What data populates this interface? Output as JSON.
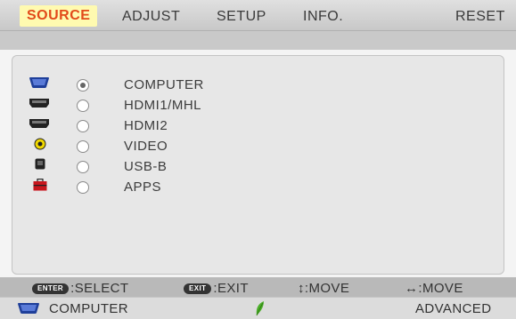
{
  "tabs": [
    {
      "label": "SOURCE",
      "active": true
    },
    {
      "label": "ADJUST",
      "active": false
    },
    {
      "label": "SETUP",
      "active": false
    },
    {
      "label": "INFO.",
      "active": false
    },
    {
      "label": "RESET",
      "active": false
    }
  ],
  "sources": [
    {
      "label": "COMPUTER",
      "icon": "computer-port-icon",
      "selected": true
    },
    {
      "label": "HDMI1/MHL",
      "icon": "hdmi-port-icon",
      "selected": false
    },
    {
      "label": "HDMI2",
      "icon": "hdmi-port-icon",
      "selected": false
    },
    {
      "label": "VIDEO",
      "icon": "video-port-icon",
      "selected": false
    },
    {
      "label": "USB-B",
      "icon": "usb-b-port-icon",
      "selected": false
    },
    {
      "label": "APPS",
      "icon": "apps-toolbox-icon",
      "selected": false
    }
  ],
  "hints": {
    "select_key": "ENTER",
    "select_label": ":SELECT",
    "exit_key": "EXIT",
    "exit_label": ":EXIT",
    "move_vertical": "↕:MOVE",
    "move_horizontal": "↔:MOVE"
  },
  "status": {
    "current_source": "COMPUTER",
    "mode": "ADVANCED"
  },
  "colors": {
    "active_tab_bg": "#fffab0",
    "active_tab_text": "#e24a1a",
    "eco_leaf": "#4caf2a",
    "port_blue": "#1f3f9a"
  }
}
